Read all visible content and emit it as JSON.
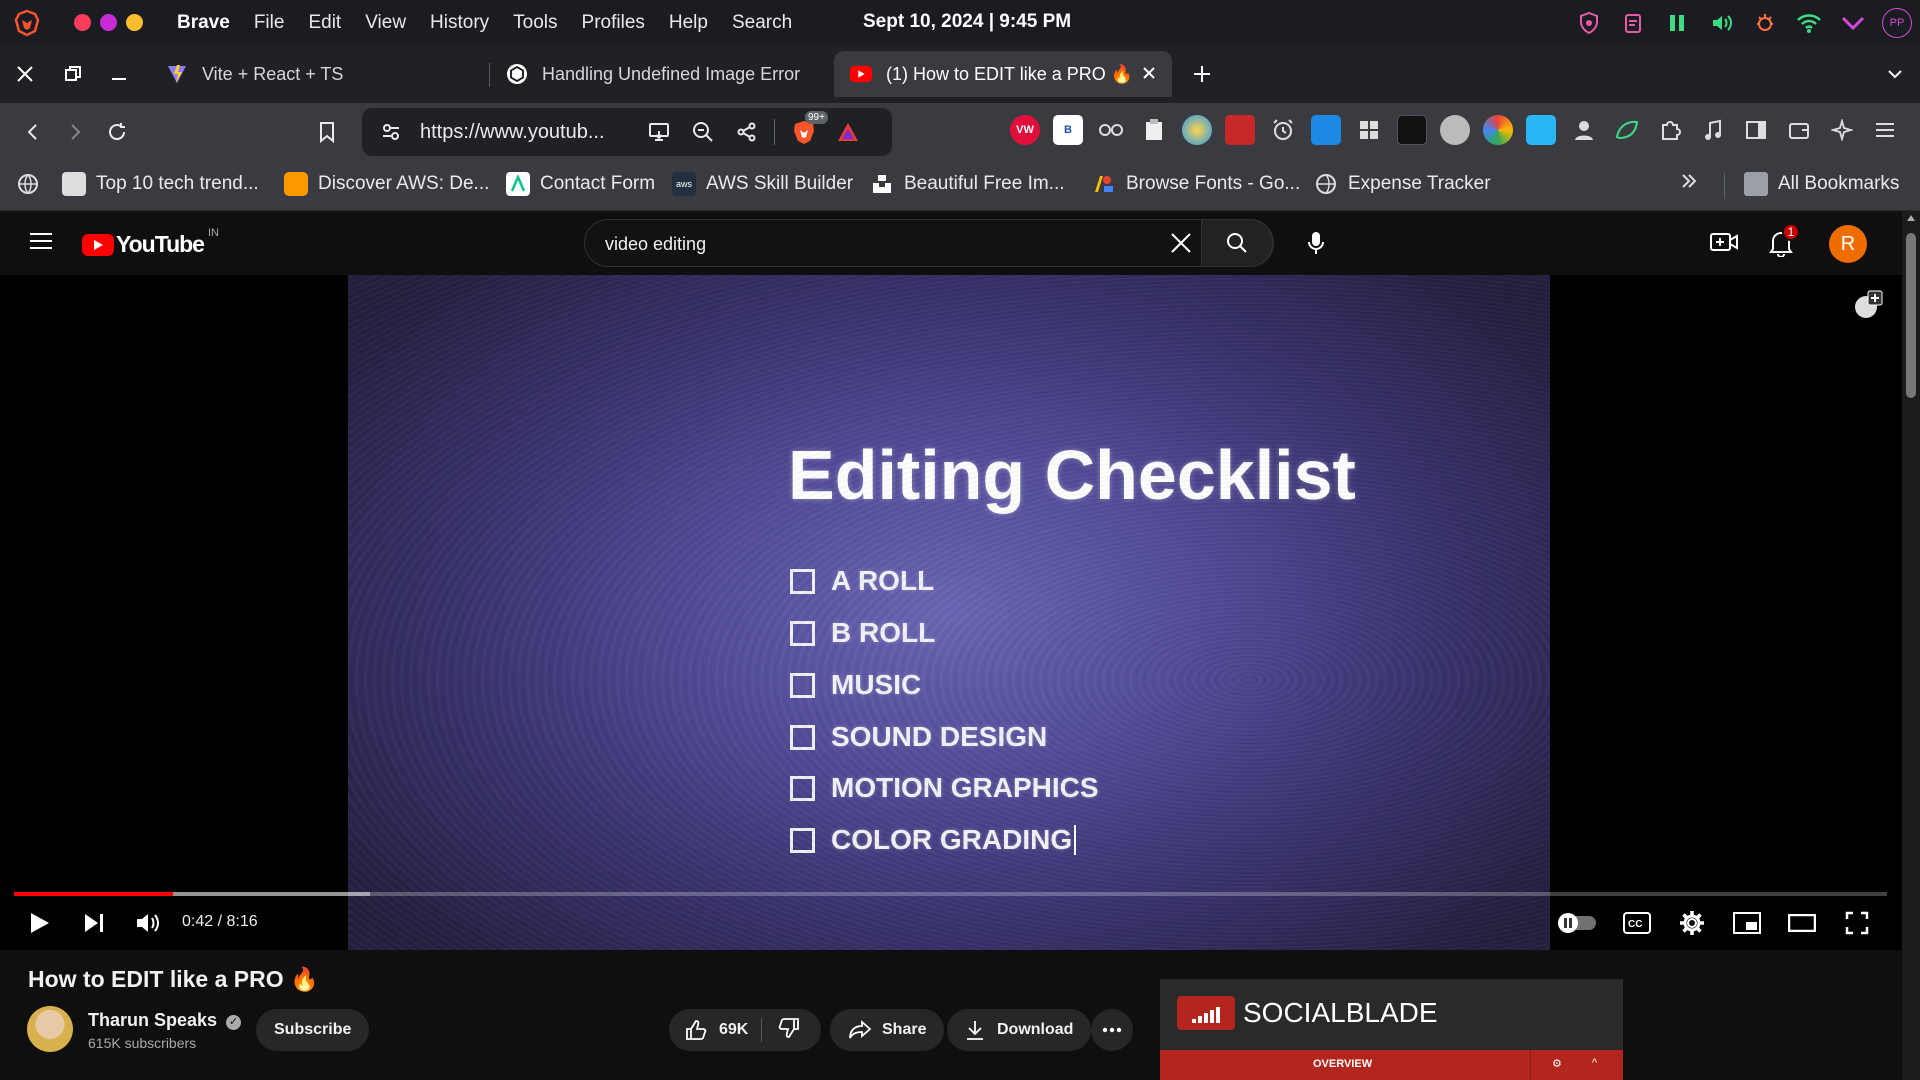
{
  "os": {
    "app_name": "Brave",
    "menu": [
      "File",
      "Edit",
      "View",
      "History",
      "Tools",
      "Profiles",
      "Help",
      "Search"
    ],
    "clock": "Sept 10, 2024 | 9:45 PM",
    "traffic_colors": [
      "#ff3b5c",
      "#c72bd6",
      "#ffbd2e"
    ],
    "tray_icons": [
      "shield-icon",
      "clipboard-icon",
      "pause-icon",
      "volume-icon",
      "bug-icon",
      "wifi-icon",
      "chevron-down-icon",
      "profile-icon"
    ],
    "profile_initials": "PP"
  },
  "tabs": [
    {
      "title": "Vite + React + TS",
      "icon": "vite-icon"
    },
    {
      "title": "Handling Undefined Image Error",
      "icon": "openai-icon"
    },
    {
      "title": "(1) How to EDIT like a PRO 🔥",
      "icon": "youtube-icon",
      "active": true
    }
  ],
  "address": {
    "url": "https://www.youtub...",
    "brave_badge": "99+"
  },
  "extensions": [
    "VW",
    "B",
    "",
    "",
    "",
    "",
    "",
    "",
    "",
    "",
    "",
    "",
    "",
    "",
    "",
    "",
    ""
  ],
  "bookmarks": [
    {
      "label": "Top 10 tech trend..."
    },
    {
      "label": "Discover AWS: De..."
    },
    {
      "label": "Contact Form"
    },
    {
      "label": "AWS Skill Builder"
    },
    {
      "label": "Beautiful Free Im..."
    },
    {
      "label": "Browse Fonts - Go..."
    },
    {
      "label": "Expense Tracker"
    }
  ],
  "all_bookmarks": "All Bookmarks",
  "youtube": {
    "logo_text": "YouTube",
    "region": "IN",
    "search_value": "video editing",
    "notification_count": "1",
    "user_initial": "R"
  },
  "video": {
    "slide_title": "Editing Checklist",
    "checklist": [
      "A ROLL",
      "B ROLL",
      "MUSIC",
      "SOUND DESIGN",
      "MOTION GRAPHICS",
      "COLOR GRADING"
    ],
    "time": "0:42 / 8:16",
    "progress_played": 0.085,
    "progress_loaded": 0.19
  },
  "details": {
    "title": "How to EDIT like a PRO 🔥",
    "channel": "Tharun Speaks",
    "subscribers": "615K subscribers",
    "subscribe_label": "Subscribe",
    "likes": "69K",
    "share_label": "Share",
    "download_label": "Download"
  },
  "socialblade": {
    "name": "SOCIALBLADE",
    "tab": "OVERVIEW"
  }
}
